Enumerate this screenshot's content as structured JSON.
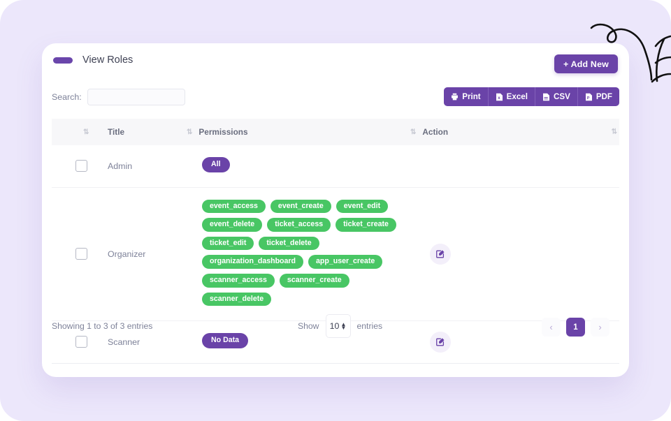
{
  "header": {
    "title": "View Roles",
    "add_new_label": "+ Add New"
  },
  "toolbar": {
    "search_label": "Search:",
    "search_value": "",
    "search_placeholder": "",
    "export_buttons": [
      {
        "label": "Print",
        "icon": "printer-icon"
      },
      {
        "label": "Excel",
        "icon": "excel-file-icon"
      },
      {
        "label": "CSV",
        "icon": "csv-file-icon"
      },
      {
        "label": "PDF",
        "icon": "pdf-file-icon"
      }
    ]
  },
  "table": {
    "columns": [
      {
        "label": ""
      },
      {
        "label": "Title"
      },
      {
        "label": "Permissions"
      },
      {
        "label": "Action"
      }
    ],
    "rows": [
      {
        "title": "Admin",
        "permissions": [
          {
            "label": "All",
            "color": "#6a43a8",
            "type": "purple"
          }
        ],
        "has_action": false,
        "checkbox": false
      },
      {
        "title": "Organizer",
        "permissions": [
          {
            "label": "event_access",
            "color": "#48c664",
            "type": "green"
          },
          {
            "label": "event_create",
            "color": "#48c664",
            "type": "green"
          },
          {
            "label": "event_edit",
            "color": "#48c664",
            "type": "green"
          },
          {
            "label": "event_delete",
            "color": "#48c664",
            "type": "green"
          },
          {
            "label": "ticket_access",
            "color": "#48c664",
            "type": "green"
          },
          {
            "label": "ticket_create",
            "color": "#48c664",
            "type": "green"
          },
          {
            "label": "ticket_edit",
            "color": "#48c664",
            "type": "green"
          },
          {
            "label": "ticket_delete",
            "color": "#48c664",
            "type": "green"
          },
          {
            "label": "organization_dashboard",
            "color": "#48c664",
            "type": "green"
          },
          {
            "label": "app_user_create",
            "color": "#48c664",
            "type": "green"
          },
          {
            "label": "scanner_access",
            "color": "#48c664",
            "type": "green"
          },
          {
            "label": "scanner_create",
            "color": "#48c664",
            "type": "green"
          },
          {
            "label": "scanner_delete",
            "color": "#48c664",
            "type": "green"
          }
        ],
        "has_action": true,
        "checkbox": false
      },
      {
        "title": "Scanner",
        "permissions": [
          {
            "label": "No Data",
            "color": "#6a43a8",
            "type": "purple"
          }
        ],
        "has_action": true,
        "checkbox": false
      }
    ]
  },
  "footer": {
    "showing_text": "Showing 1 to 3 of 3 entries",
    "show_label": "Show",
    "entries_value": "10",
    "entries_label": "entries",
    "pagination": {
      "prev": "‹",
      "next": "›",
      "pages": [
        "1"
      ],
      "active_page": "1"
    }
  },
  "colors": {
    "accent_purple": "#6a43a8",
    "badge_green": "#48c664",
    "page_background": "#ece7fb",
    "card_background": "#ffffff"
  }
}
